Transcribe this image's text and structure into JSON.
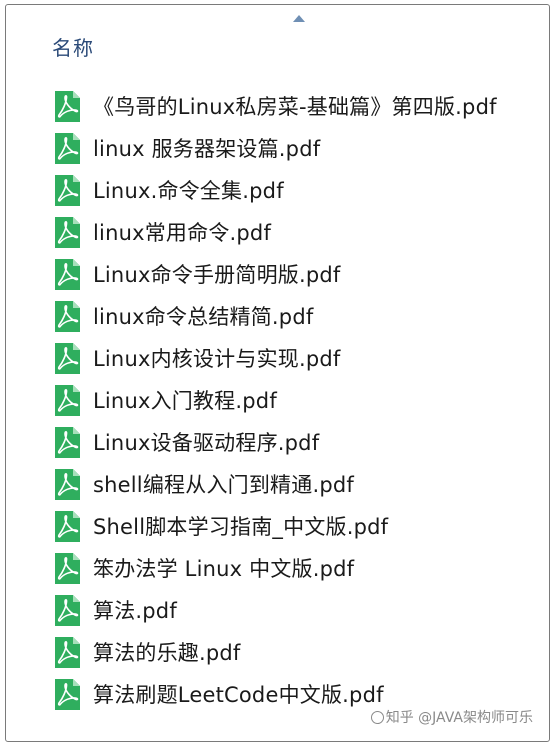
{
  "header": {
    "column_label": "名称",
    "sort_indicator": "sort-ascending-arrow"
  },
  "files": [
    {
      "name": "《鸟哥的Linux私房菜-基础篇》第四版.pdf",
      "icon": "pdf-file-icon"
    },
    {
      "name": "linux 服务器架设篇.pdf",
      "icon": "pdf-file-icon"
    },
    {
      "name": "Linux.命令全集.pdf",
      "icon": "pdf-file-icon"
    },
    {
      "name": "linux常用命令.pdf",
      "icon": "pdf-file-icon"
    },
    {
      "name": "Linux命令手册简明版.pdf",
      "icon": "pdf-file-icon"
    },
    {
      "name": "linux命令总结精简.pdf",
      "icon": "pdf-file-icon"
    },
    {
      "name": "Linux内核设计与实现.pdf",
      "icon": "pdf-file-icon"
    },
    {
      "name": "Linux入门教程.pdf",
      "icon": "pdf-file-icon"
    },
    {
      "name": "Linux设备驱动程序.pdf",
      "icon": "pdf-file-icon"
    },
    {
      "name": "shell编程从入门到精通.pdf",
      "icon": "pdf-file-icon"
    },
    {
      "name": "Shell脚本学习指南_中文版.pdf",
      "icon": "pdf-file-icon"
    },
    {
      "name": "笨办法学 Linux 中文版.pdf",
      "icon": "pdf-file-icon"
    },
    {
      "name": "算法.pdf",
      "icon": "pdf-file-icon"
    },
    {
      "name": "算法的乐趣.pdf",
      "icon": "pdf-file-icon"
    },
    {
      "name": "算法刷题LeetCode中文版.pdf",
      "icon": "pdf-file-icon"
    }
  ],
  "watermark": {
    "text": "知乎 @JAVA架构师可乐"
  },
  "colors": {
    "pdf_icon_green": "#2fae5e",
    "header_text": "#2b4a78",
    "sort_arrow": "#6f8fb4",
    "frame_border": "#7a7a7a"
  }
}
